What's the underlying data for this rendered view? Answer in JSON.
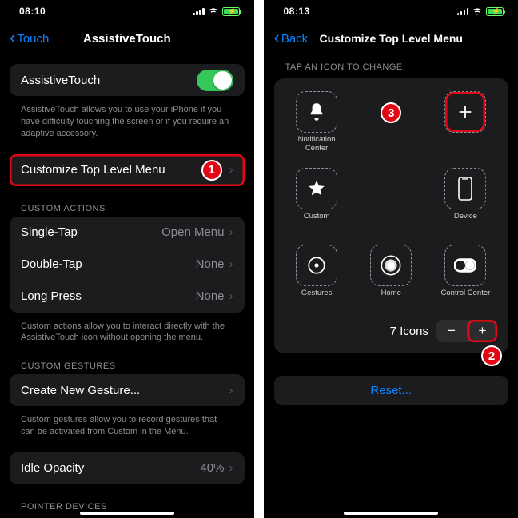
{
  "left": {
    "status_time": "08:10",
    "back_label": "Touch",
    "title": "AssistiveTouch",
    "toggle_label": "AssistiveTouch",
    "toggle_desc": "AssistiveTouch allows you to use your iPhone if you have difficulty touching the screen or if you require an adaptive accessory.",
    "customize_label": "Customize Top Level Menu",
    "custom_actions_header": "CUSTOM ACTIONS",
    "single_tap_label": "Single-Tap",
    "single_tap_value": "Open Menu",
    "double_tap_label": "Double-Tap",
    "double_tap_value": "None",
    "long_press_label": "Long Press",
    "long_press_value": "None",
    "custom_actions_desc": "Custom actions allow you to interact directly with the AssistiveTouch icon without opening the menu.",
    "custom_gestures_header": "CUSTOM GESTURES",
    "create_gesture_label": "Create New Gesture...",
    "custom_gestures_desc": "Custom gestures allow you to record gestures that can be activated from Custom in the Menu.",
    "idle_opacity_label": "Idle Opacity",
    "idle_opacity_value": "40%",
    "pointer_devices_header": "POINTER DEVICES"
  },
  "right": {
    "status_time": "08:13",
    "back_label": "Back",
    "title": "Customize Top Level Menu",
    "tap_header": "TAP AN ICON TO CHANGE:",
    "icons": [
      {
        "name": "notification-center",
        "label": "Notification Center"
      },
      {
        "name": "plus-empty",
        "label": ""
      },
      {
        "name": "plus-empty",
        "label": ""
      },
      {
        "name": "custom",
        "label": "Custom"
      },
      {
        "name": "blank",
        "label": ""
      },
      {
        "name": "device",
        "label": "Device"
      },
      {
        "name": "gestures",
        "label": "Gestures"
      },
      {
        "name": "home",
        "label": "Home"
      },
      {
        "name": "control-center",
        "label": "Control Center"
      }
    ],
    "count_label": "7 Icons",
    "reset_label": "Reset...",
    "badges": {
      "one": "1",
      "two": "2",
      "three": "3"
    }
  }
}
